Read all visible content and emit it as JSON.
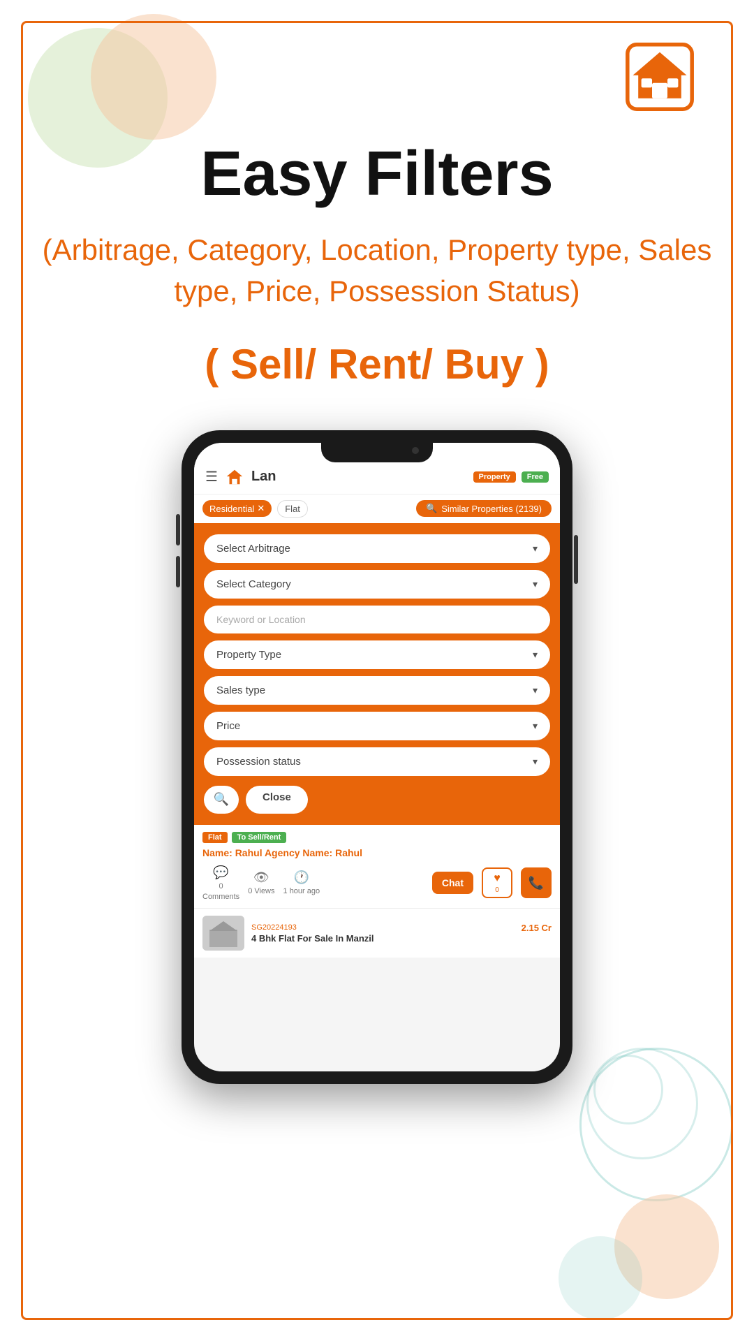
{
  "page": {
    "title": "Easy Filters",
    "subtitle": "(Arbitrage, Category, Location,  Property type, Sales type, Price, Possession Status)",
    "sell_rent_buy": "( Sell/ Rent/ Buy )"
  },
  "app_bar": {
    "title": "Lan",
    "property_badge": "Property",
    "free_badge": "Free"
  },
  "filter_tags": {
    "residential": "Residential",
    "flat": "Flat",
    "similar_results": "Similar Properties (2139)"
  },
  "filters": {
    "select_arbitrage": "Select Arbitrage",
    "select_category": "Select Category",
    "keyword_location": "Keyword or Location",
    "property_type": "Property Type",
    "sales_type": "Sales type",
    "price": "Price",
    "possession_status": "Possession status",
    "search_btn": "🔍",
    "close_btn": "Close"
  },
  "listing": {
    "badge_flat": "Flat",
    "badge_sell_rent": "To Sell/Rent",
    "name_label": "Name: ",
    "name_value": "Rahul",
    "agency_label": " Agency Name: Rahul",
    "comments_count": "0",
    "comments_label": "Comments",
    "views_count": "0 Views",
    "time_label": "1 hour ago",
    "chat_label": "Chat",
    "like_count": "0"
  },
  "bottom_listing": {
    "listing_id": "SG20224193",
    "price": "2.15 Cr",
    "title": "4 Bhk Flat For Sale In Manzil"
  },
  "icons": {
    "house": "house-icon",
    "hamburger": "☰",
    "chevron_down": "▾",
    "search": "🔍",
    "chat_bubble": "💬",
    "eye": "👁",
    "clock": "🕐",
    "heart": "♥",
    "phone": "📞"
  }
}
